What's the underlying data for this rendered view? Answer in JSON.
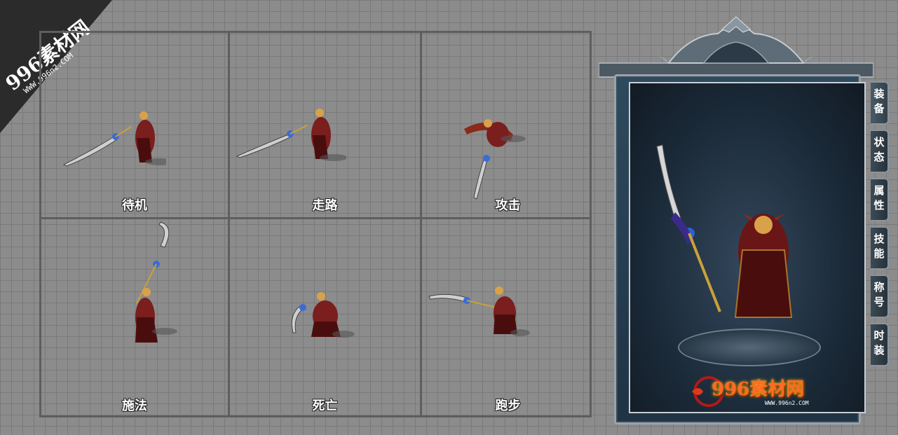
{
  "watermark": {
    "title": "996素材网",
    "url": "WWW.996n2.COM"
  },
  "sprite_grid": {
    "cells": [
      {
        "label": "待机"
      },
      {
        "label": "走路"
      },
      {
        "label": "攻击"
      },
      {
        "label": "施法"
      },
      {
        "label": "死亡"
      },
      {
        "label": "跑步"
      }
    ]
  },
  "character_panel": {
    "tabs": [
      {
        "label": "装备"
      },
      {
        "label": "状态"
      },
      {
        "label": "属性"
      },
      {
        "label": "技能"
      },
      {
        "label": "称号"
      },
      {
        "label": "时装"
      }
    ],
    "logo_text": "996素材网",
    "logo_url": "WWW.996n2.COM"
  },
  "colors": {
    "background": "#8c8c8c",
    "grid_line": "#5e5e5e",
    "panel_bg": "#1f3344",
    "logo": "#ff6a2a"
  }
}
